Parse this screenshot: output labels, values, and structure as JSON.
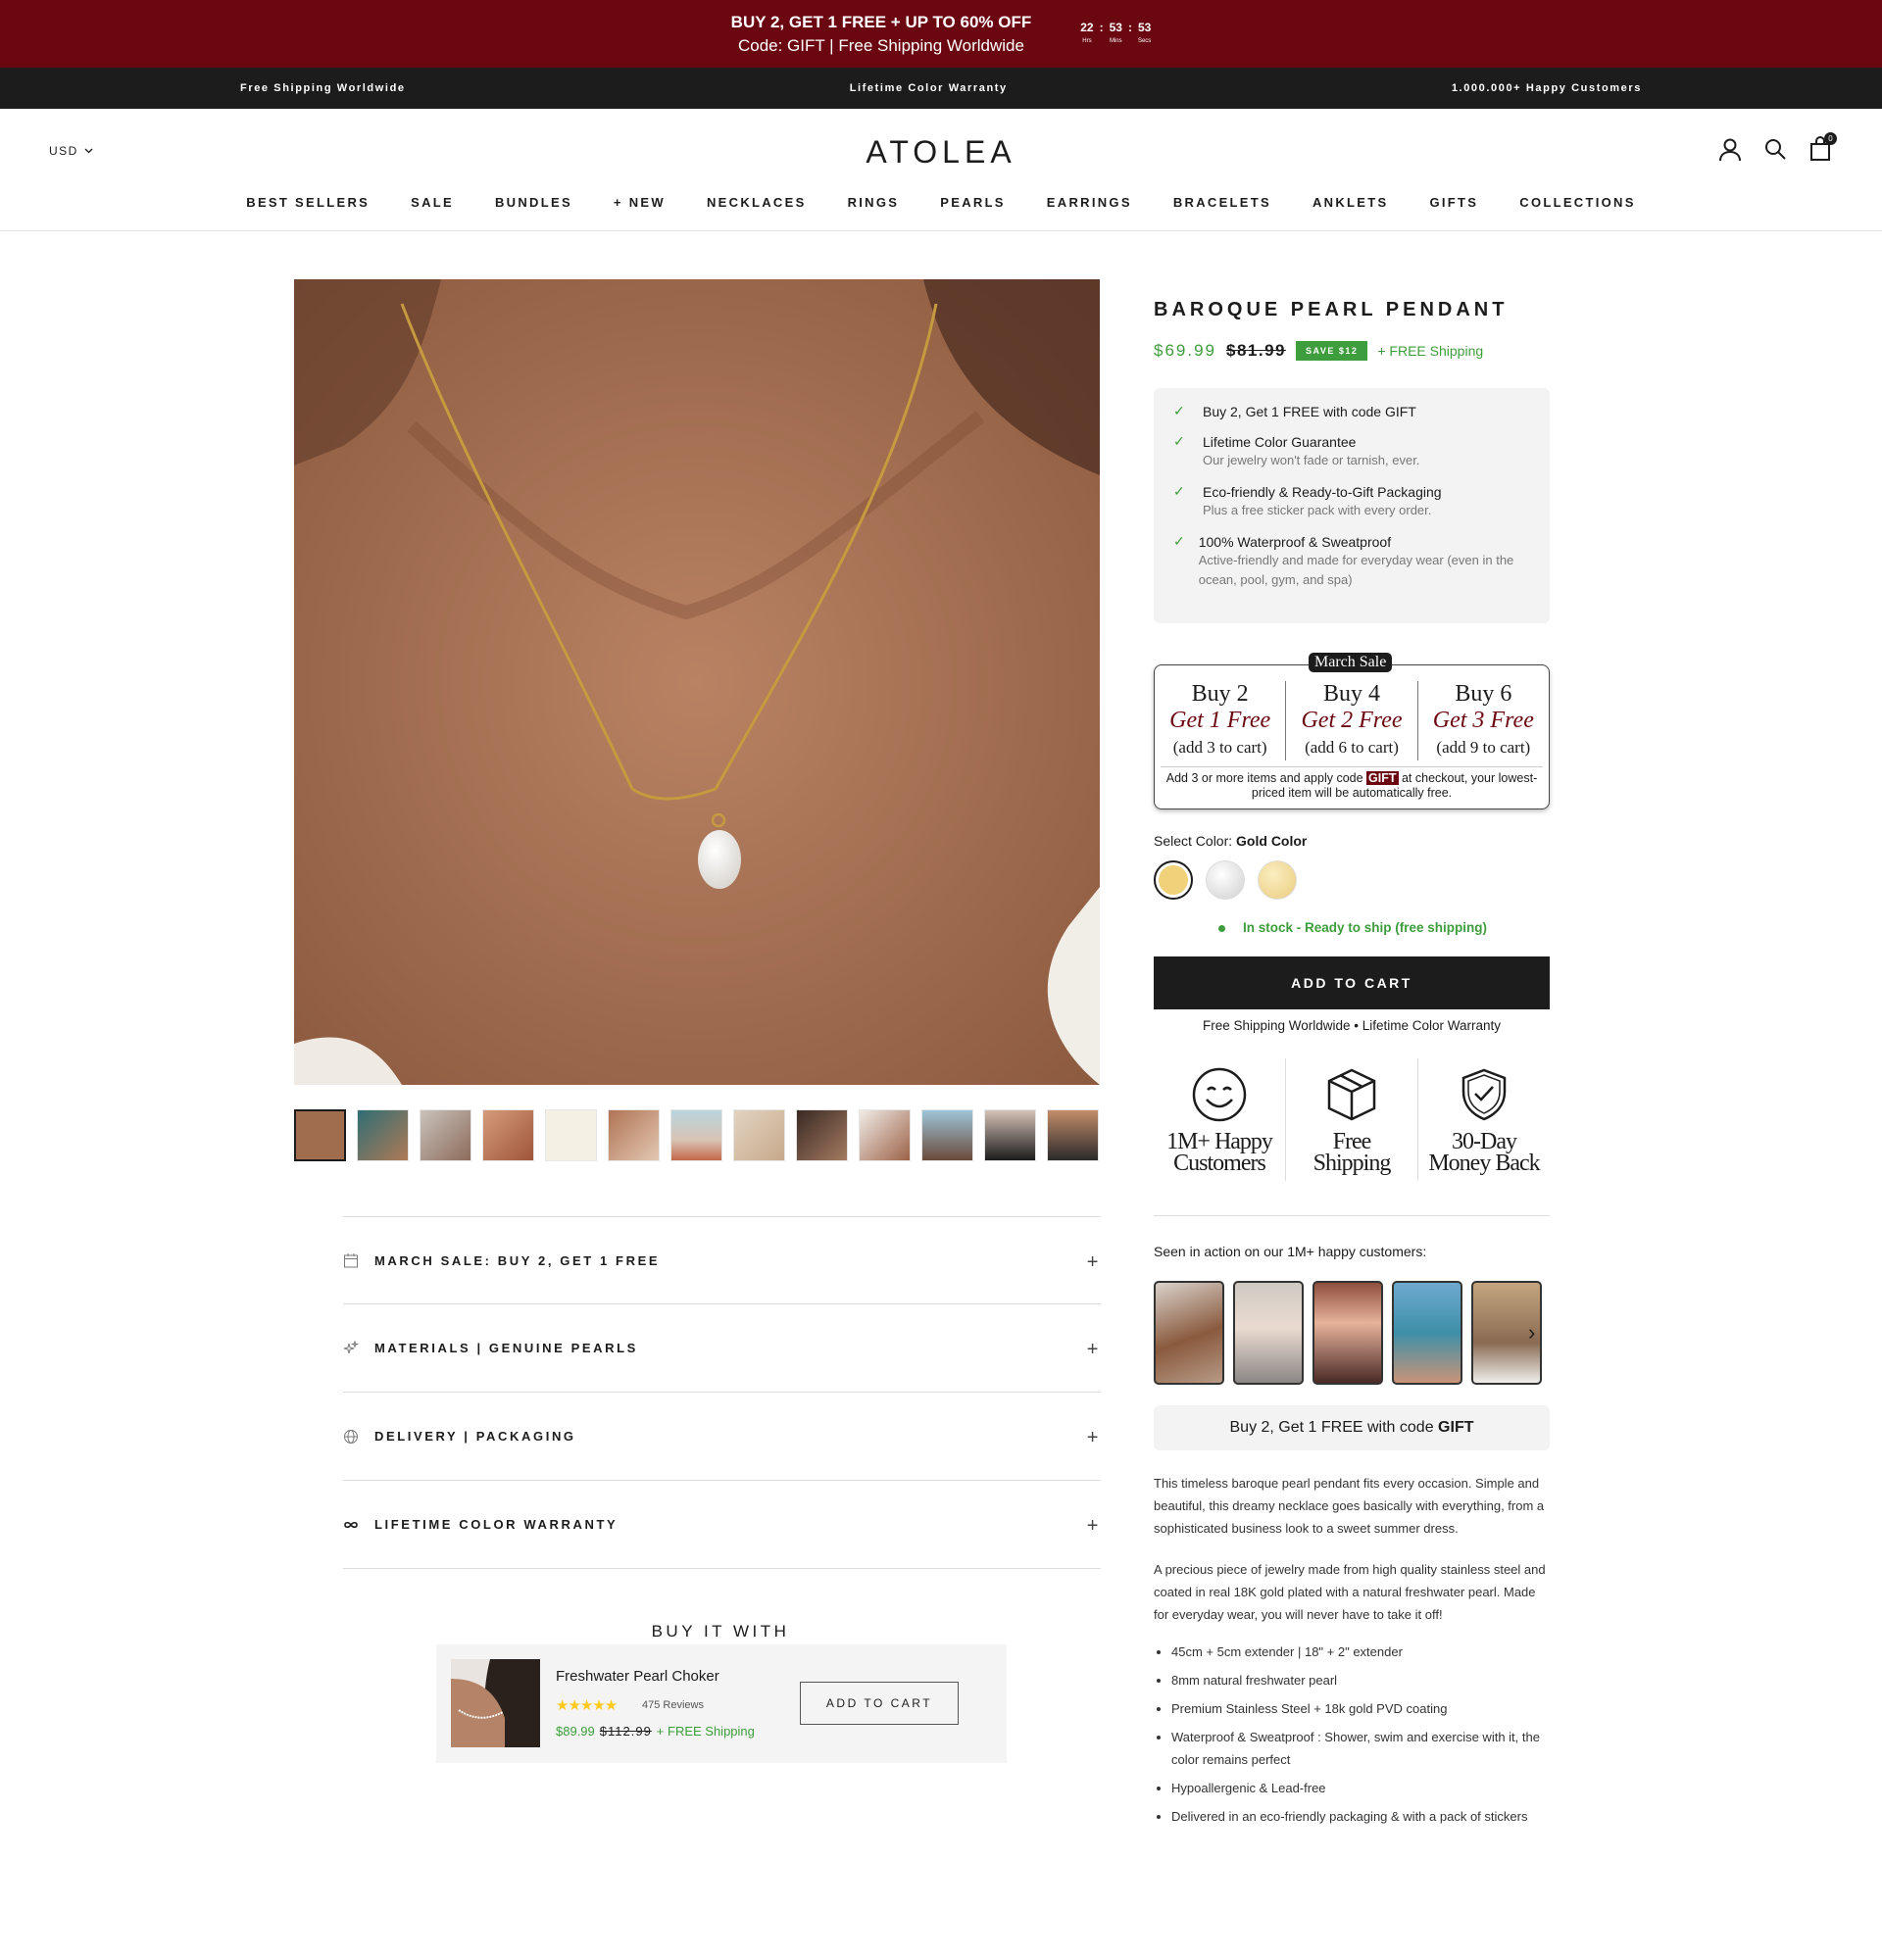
{
  "promo": {
    "line1": "BUY 2, GET 1 FREE + UP TO 60% OFF",
    "line2": "Code: GIFT | Free Shipping Worldwide",
    "countdown": [
      {
        "value": "22",
        "unit": "Hrs"
      },
      {
        "value": "53",
        "unit": "Mins"
      },
      {
        "value": "53",
        "unit": "Secs"
      }
    ]
  },
  "strip": [
    "Free Shipping Worldwide",
    "Lifetime Color Warranty",
    "1.000.000+ Happy Customers"
  ],
  "header": {
    "currency": "USD",
    "logo": "ATOLEA",
    "cart_count": "0"
  },
  "nav": [
    "BEST SELLERS",
    "SALE",
    "BUNDLES",
    "+ NEW",
    "NECKLACES",
    "RINGS",
    "PEARLS",
    "EARRINGS",
    "BRACELETS",
    "ANKLETS",
    "GIFTS",
    "COLLECTIONS"
  ],
  "accordion": [
    "MARCH SALE: BUY 2, GET 1 FREE",
    "MATERIALS | GENUINE PEARLS",
    "DELIVERY | PACKAGING",
    "LIFETIME COLOR WARRANTY"
  ],
  "buy_it_with": {
    "title": "BUY IT WITH",
    "name": "Freshwater Pearl Choker",
    "stars": "★★★★★",
    "reviews": "475 Reviews",
    "price": "$89.99",
    "compare": "$112.99",
    "shipping": "+ FREE Shipping",
    "button": "ADD TO CART"
  },
  "product": {
    "title": "BAROQUE PEARL PENDANT",
    "price": "$69.99",
    "compare": "$81.99",
    "save": "SAVE $12",
    "shipping": "+ FREE Shipping",
    "benefits": [
      {
        "title": "Buy 2, Get 1 FREE with code GIFT",
        "sub": ""
      },
      {
        "title": "Lifetime Color Guarantee",
        "sub": "Our jewelry won't fade or tarnish, ever."
      },
      {
        "title": "Eco-friendly & Ready-to-Gift Packaging",
        "sub": "Plus a free sticker pack with every order."
      },
      {
        "title": "100% Waterproof & Sweatproof",
        "sub": "Active-friendly and made for everyday wear (even in the ocean, pool, gym, and spa)"
      }
    ],
    "sale": {
      "tag": "March Sale",
      "offers": [
        {
          "a": "Buy 2",
          "b": "Get 1 Free",
          "c": "(add 3 to cart)"
        },
        {
          "a": "Buy 4",
          "b": "Get 2 Free",
          "c": "(add 6 to cart)"
        },
        {
          "a": "Buy 6",
          "b": "Get 3 Free",
          "c": "(add 9 to cart)"
        }
      ],
      "note_pre": "Add 3 or more items and apply code ",
      "note_code": "GIFT",
      "note_post": " at checkout, your lowest-priced item will be automatically free."
    },
    "color_label": "Select Color:",
    "color_value": "Gold Color",
    "stock": "In stock - Ready to ship (free shipping)",
    "add_to_cart": "ADD TO CART",
    "atc_sub": "Free Shipping Worldwide  •  Lifetime Color Warranty",
    "trust": [
      {
        "l1": "1M+ Happy",
        "l2": "Customers"
      },
      {
        "l1": "Free",
        "l2": "Shipping"
      },
      {
        "l1": "30-Day",
        "l2": "Money Back"
      }
    ],
    "seen": "Seen in action on our 1M+ happy customers:",
    "gift_pre": "Buy 2, Get 1 FREE with code ",
    "gift_code": "GIFT",
    "desc1": "This timeless baroque pearl pendant fits every occasion. Simple and beautiful, this dreamy necklace goes basically with everything, from a sophisticated business look to a sweet summer dress.",
    "desc2": "A precious piece of jewelry made from high quality stainless steel and coated in real 18K gold plated with a natural freshwater pearl. Made for everyday wear, you will never have to take it off!",
    "bullets": [
      "45cm + 5cm extender | 18\" + 2\" extender",
      "8mm natural freshwater pearl",
      "Premium Stainless Steel + 18k gold PVD coating",
      "Waterproof & Sweatproof : Shower, swim and exercise with it, the color remains perfect",
      "Hypoallergenic & Lead-free",
      "Delivered in an eco-friendly packaging & with a pack of stickers"
    ]
  },
  "colors": {
    "promo": "#6b0710",
    "dark": "#1c1c1c",
    "green": "#3e9d3c",
    "gold": "#f0d27a",
    "silver": "#e2e2e2"
  }
}
